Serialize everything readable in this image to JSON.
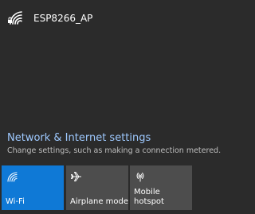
{
  "network": {
    "name": "ESP8266_AP",
    "icon": "wifi-secured-icon"
  },
  "settings": {
    "link_label": "Network & Internet settings",
    "description": "Change settings, such as making a connection metered."
  },
  "tiles": [
    {
      "label": "Wi-Fi",
      "icon": "wifi-icon",
      "active": true
    },
    {
      "label": "Airplane mode",
      "icon": "airplane-icon",
      "active": false
    },
    {
      "label": "Mobile hotspot",
      "icon": "hotspot-icon",
      "active": false
    }
  ],
  "colors": {
    "background": "#2b2b2b",
    "accent": "#0f79d6",
    "tile_inactive": "#4d4d4d",
    "link": "#9ec9ff"
  }
}
